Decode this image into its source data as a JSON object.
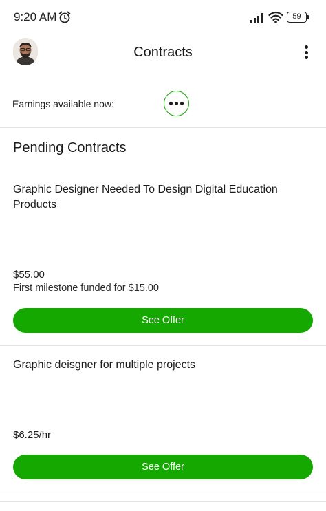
{
  "status_bar": {
    "time": "9:20 AM",
    "battery": "59",
    "icons": [
      "alarm-icon",
      "signal-icon",
      "wifi-icon",
      "battery-icon"
    ]
  },
  "header": {
    "title": "Contracts",
    "avatar_icon": "avatar",
    "menu_icon": "more-vertical-icon"
  },
  "earnings": {
    "label": "Earnings available now:",
    "more_icon": "more-horizontal-icon"
  },
  "pending": {
    "section_title": "Pending Contracts",
    "contracts": [
      {
        "title": "Graphic Designer Needed To Design Digital Education Products",
        "rate": "$55.00",
        "milestone": "First milestone funded for $15.00",
        "button_label": "See Offer"
      },
      {
        "title": "Graphic deisgner for multiple projects",
        "rate": "$6.25/hr",
        "button_label": "See Offer"
      }
    ]
  },
  "colors": {
    "accent": "#14a800",
    "text": "#1b1b1b",
    "divider": "#e4e4e4",
    "background": "#ffffff"
  }
}
